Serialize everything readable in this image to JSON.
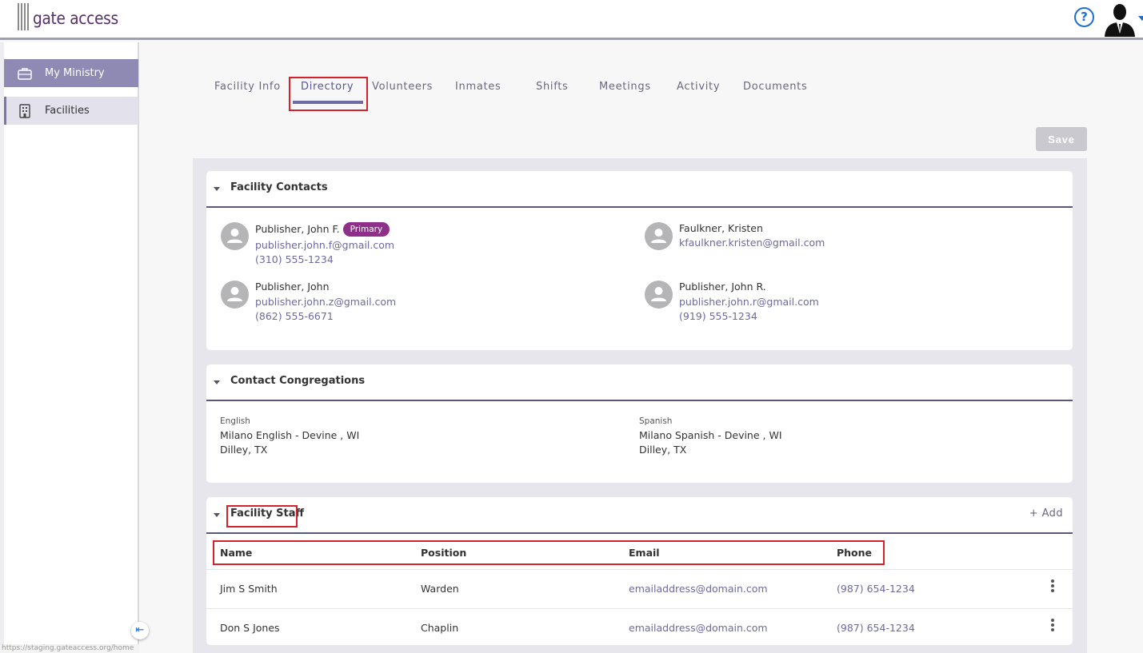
{
  "app": {
    "logo_text": "gate access"
  },
  "header": {
    "help_icon": "question-circle-icon",
    "help_glyph": "?",
    "avatar_icon": "user-silhouette-icon"
  },
  "sidebar": {
    "items": [
      {
        "label": "My Ministry",
        "icon": "briefcase-icon",
        "active": true
      },
      {
        "label": "Facilities",
        "icon": "building-icon",
        "active": false
      }
    ],
    "collapse_icon": "collapse-left-icon",
    "collapse_glyph": "⇤",
    "status_url": "https://staging.gateaccess.org/home"
  },
  "tabs": [
    {
      "label": "Facility Info"
    },
    {
      "label": "Directory",
      "active": true
    },
    {
      "label": "Volunteers"
    },
    {
      "label": "Inmates"
    },
    {
      "label": "Shifts"
    },
    {
      "label": "Meetings"
    },
    {
      "label": "Activity"
    },
    {
      "label": "Documents"
    }
  ],
  "toolbar": {
    "save_label": "Save"
  },
  "facility_contacts": {
    "title": "Facility Contacts",
    "contacts": [
      {
        "name": "Publisher, John F.",
        "badge": "Primary",
        "email": "publisher.john.f@gmail.com",
        "phone": "(310) 555-1234"
      },
      {
        "name": "Faulkner, Kristen",
        "email": "kfaulkner.kristen@gmail.com"
      },
      {
        "name": "Publisher, John",
        "email": "publisher.john.z@gmail.com",
        "phone": "(862) 555-6671"
      },
      {
        "name": "Publisher, John R.",
        "email": "publisher.john.r@gmail.com",
        "phone": "(919) 555-1234"
      }
    ]
  },
  "contact_congregations": {
    "title": "Contact Congregations",
    "items": [
      {
        "language": "English",
        "name": "Milano English - Devine , WI",
        "location": "Dilley, TX"
      },
      {
        "language": "Spanish",
        "name": "Milano Spanish - Devine , WI",
        "location": "Dilley, TX"
      }
    ]
  },
  "facility_staff": {
    "title": "Facility Staff",
    "add_label": "+ Add",
    "columns": [
      "Name",
      "Position",
      "Email",
      "Phone"
    ],
    "rows": [
      {
        "name": "Jim S Smith",
        "position": "Warden",
        "email": "emailaddress@domain.com",
        "phone": "(987) 654-1234"
      },
      {
        "name": "Don S Jones",
        "position": "Chaplin",
        "email": "emailaddress@domain.com",
        "phone": "(987) 654-1234"
      }
    ],
    "row_menu_icon": "kebab-menu-icon"
  },
  "colors": {
    "accent": "#6e6aa6",
    "highlight": "#d4222a",
    "badge": "#8e2f8a",
    "link": "#6c6aa0"
  }
}
